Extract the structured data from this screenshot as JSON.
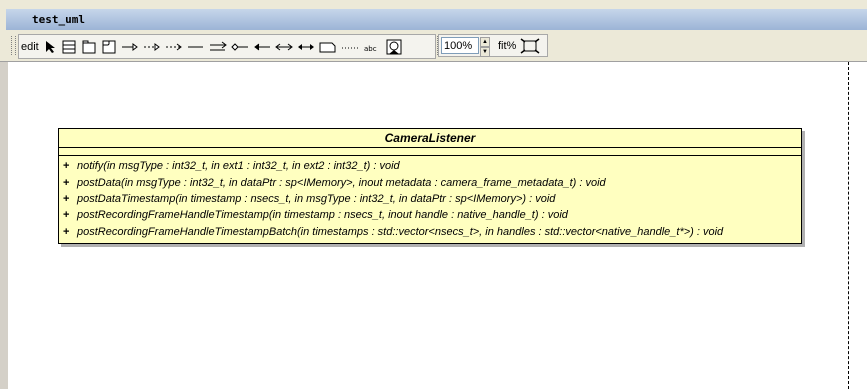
{
  "window": {
    "title": "test_uml"
  },
  "toolbar": {
    "edit_label": "edit",
    "zoom_value": "100%",
    "fit_label": "fit%",
    "tools": [
      {
        "icon": "select-arrow-icon"
      },
      {
        "icon": "class-icon"
      },
      {
        "icon": "package-icon"
      },
      {
        "icon": "fragment-icon"
      },
      {
        "icon": "generalisation-arrow-icon"
      },
      {
        "icon": "realization-arrow-icon"
      },
      {
        "icon": "dependency-arrow-icon"
      },
      {
        "icon": "association-line-icon"
      },
      {
        "icon": "directional-aggregation-icon"
      },
      {
        "icon": "aggregation-icon"
      },
      {
        "icon": "directional-association-icon"
      },
      {
        "icon": "bidirectional-association-icon"
      },
      {
        "icon": "composition-icon"
      },
      {
        "icon": "note-icon"
      },
      {
        "icon": "anchor-line-icon"
      },
      {
        "icon": "text-icon"
      },
      {
        "icon": "image-icon"
      }
    ],
    "optimal_window_icon": "fit-window-icon"
  },
  "diagram": {
    "class": {
      "name": "CameraListener",
      "operations": [
        {
          "visibility": "+",
          "signature": "notify(in msgType : int32_t, in ext1 : int32_t, in ext2 : int32_t) : void"
        },
        {
          "visibility": "+",
          "signature": "postData(in msgType : int32_t, in dataPtr : sp<IMemory>, inout metadata : camera_frame_metadata_t) : void"
        },
        {
          "visibility": "+",
          "signature": "postDataTimestamp(in timestamp : nsecs_t, in msgType : int32_t, in dataPtr : sp<IMemory>) : void"
        },
        {
          "visibility": "+",
          "signature": "postRecordingFrameHandleTimestamp(in timestamp : nsecs_t, inout handle : native_handle_t) : void"
        },
        {
          "visibility": "+",
          "signature": "postRecordingFrameHandleTimestampBatch(in timestamps : std::vector<nsecs_t>, in handles : std::vector<native_handle_t*>) : void"
        }
      ]
    }
  }
}
